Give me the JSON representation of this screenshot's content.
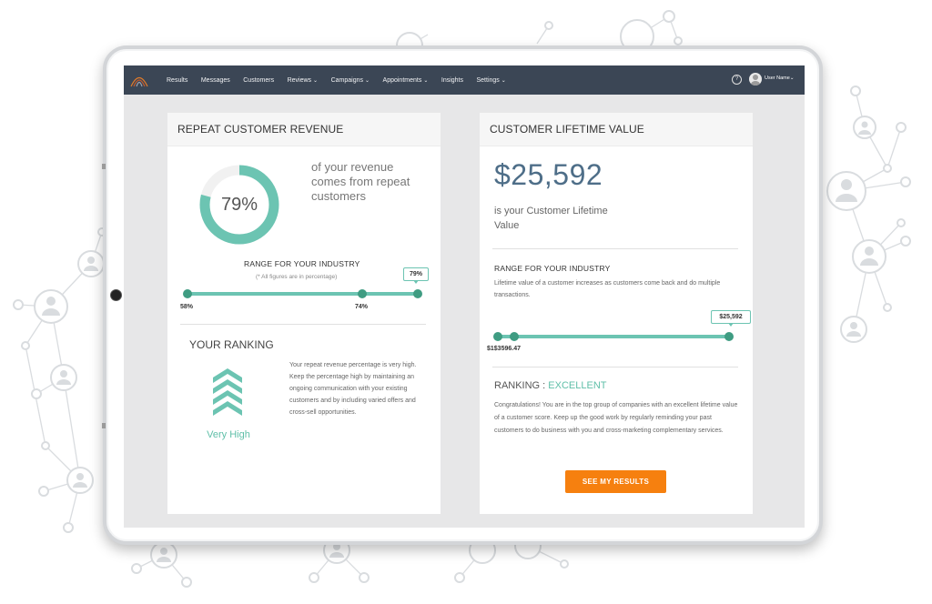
{
  "nav": {
    "items": [
      {
        "label": "Results",
        "dropdown": false
      },
      {
        "label": "Messages",
        "dropdown": false
      },
      {
        "label": "Customers",
        "dropdown": false
      },
      {
        "label": "Reviews",
        "dropdown": true
      },
      {
        "label": "Campaigns",
        "dropdown": true
      },
      {
        "label": "Appointments",
        "dropdown": true
      },
      {
        "label": "Insights",
        "dropdown": false
      },
      {
        "label": "Settings",
        "dropdown": true
      }
    ],
    "help_glyph": "?",
    "user_name": "User Name",
    "chevron_glyph": "⌄"
  },
  "repeat_revenue": {
    "title": "REPEAT CUSTOMER REVENUE",
    "percent_label": "79%",
    "percent_value": 0.79,
    "description": "of your revenue comes from repeat customers",
    "range_title": "RANGE FOR YOUR INDUSTRY",
    "range_note": "(* All figures are in percentage)",
    "range_low": "58%",
    "range_mid": "74%",
    "your_value": "79%",
    "ranking_title": "YOUR RANKING",
    "ranking_value": "Very High",
    "ranking_desc": "Your repeat revenue percentage is very high. Keep the percentage high by maintaining an ongoing communication with your existing customers and by including varied offers and cross-sell opportunities."
  },
  "lifetime_value": {
    "title": "CUSTOMER LIFETIME VALUE",
    "value": "$25,592",
    "value_caption": "is your Customer Lifetime Value",
    "range_title": "RANGE FOR YOUR INDUSTRY",
    "range_desc": "Lifetime value of a customer increases as customers come back and do multiple transactions.",
    "range_labels": "$1$3596.47",
    "your_value": "$25,592",
    "ranking_label": "RANKING : ",
    "ranking_value": "EXCELLENT",
    "ranking_desc": "Congratulations! You are in the top group of companies with an excellent lifetime value of a customer score. Keep up the good work by regularly reminding your past customers to do business with you and cross-marketing complementary services.",
    "cta": "SEE MY RESULTS"
  },
  "colors": {
    "nav_bg": "#3b4655",
    "teal": "#6cc4b2",
    "teal_dark": "#3f9c82",
    "value_blue": "#4e6e88",
    "cta_orange": "#f6800f"
  }
}
